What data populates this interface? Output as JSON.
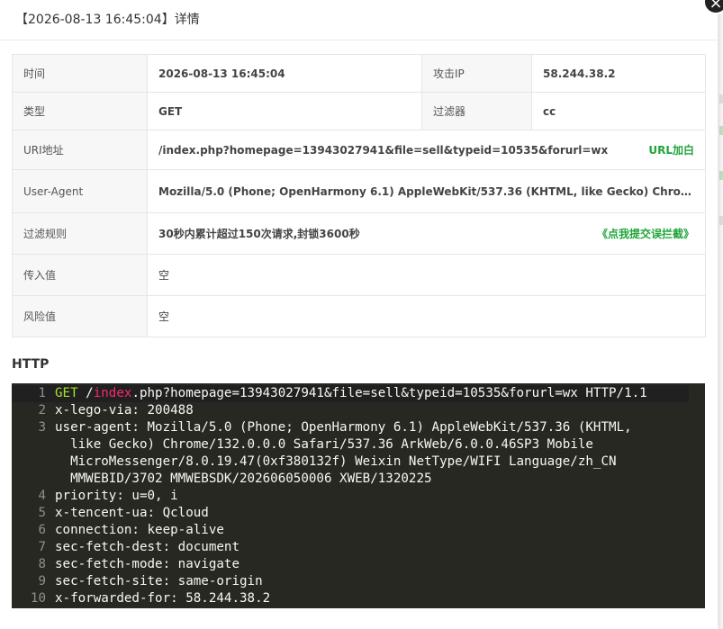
{
  "dialog": {
    "title": "【2026-08-13 16:45:04】详情",
    "close_glyph": "×"
  },
  "info": {
    "time_label": "时间",
    "time_value": "2026-08-13 16:45:04",
    "ip_label": "攻击IP",
    "ip_value": "58.244.38.2",
    "type_label": "类型",
    "type_value": "GET",
    "filter_label": "过滤器",
    "filter_value": "cc",
    "uri_label": "URI地址",
    "uri_value": "/index.php?homepage=13943027941&file=sell&typeid=10535&forurl=wx",
    "uri_action": "URL加白",
    "ua_label": "User-Agent",
    "ua_value": "Mozilla/5.0 (Phone; OpenHarmony 6.1) AppleWebKit/537.36 (KHTML, like Gecko) Chrome/1...",
    "rule_label": "过滤规则",
    "rule_value": "30秒内累计超过150次请求,封锁3600秒",
    "rule_action": "《点我提交误拦截》",
    "input_label": "传入值",
    "input_value": "空",
    "risk_label": "风险值",
    "risk_value": "空"
  },
  "http": {
    "title": "HTTP",
    "request": {
      "method": "GET",
      "slash": "/",
      "path": "index",
      "rest": ".php?homepage=13943027941&file=sell&typeid=10535&forurl=wx HTTP/1.1"
    },
    "lines": [
      {
        "num": "1"
      },
      {
        "num": "2",
        "text": "x-lego-via: 200488"
      },
      {
        "num": "3",
        "text": "user-agent: Mozilla/5.0 (Phone; OpenHarmony 6.1) AppleWebKit/537.36 (KHTML,"
      },
      {
        "num": "",
        "text": "  like Gecko) Chrome/132.0.0.0 Safari/537.36 ArkWeb/6.0.0.46SP3 Mobile"
      },
      {
        "num": "",
        "text": "  MicroMessenger/8.0.19.47(0xf380132f) Weixin NetType/WIFI Language/zh_CN"
      },
      {
        "num": "",
        "text": "  MMWEBID/3702 MMWEBSDK/202606050006 XWEB/1320225"
      },
      {
        "num": "4",
        "text": "priority: u=0, i"
      },
      {
        "num": "5",
        "text": "x-tencent-ua: Qcloud"
      },
      {
        "num": "6",
        "text": "connection: keep-alive"
      },
      {
        "num": "7",
        "text": "sec-fetch-dest: document"
      },
      {
        "num": "8",
        "text": "sec-fetch-mode: navigate"
      },
      {
        "num": "9",
        "text": "sec-fetch-site: same-origin"
      },
      {
        "num": "10",
        "text": "x-forwarded-for: 58.244.38.2"
      }
    ]
  },
  "colors": {
    "accent_green": "#20a53a",
    "code_bg": "#272822",
    "keyword_green": "#a6e22e",
    "keyword_red": "#f92672"
  }
}
